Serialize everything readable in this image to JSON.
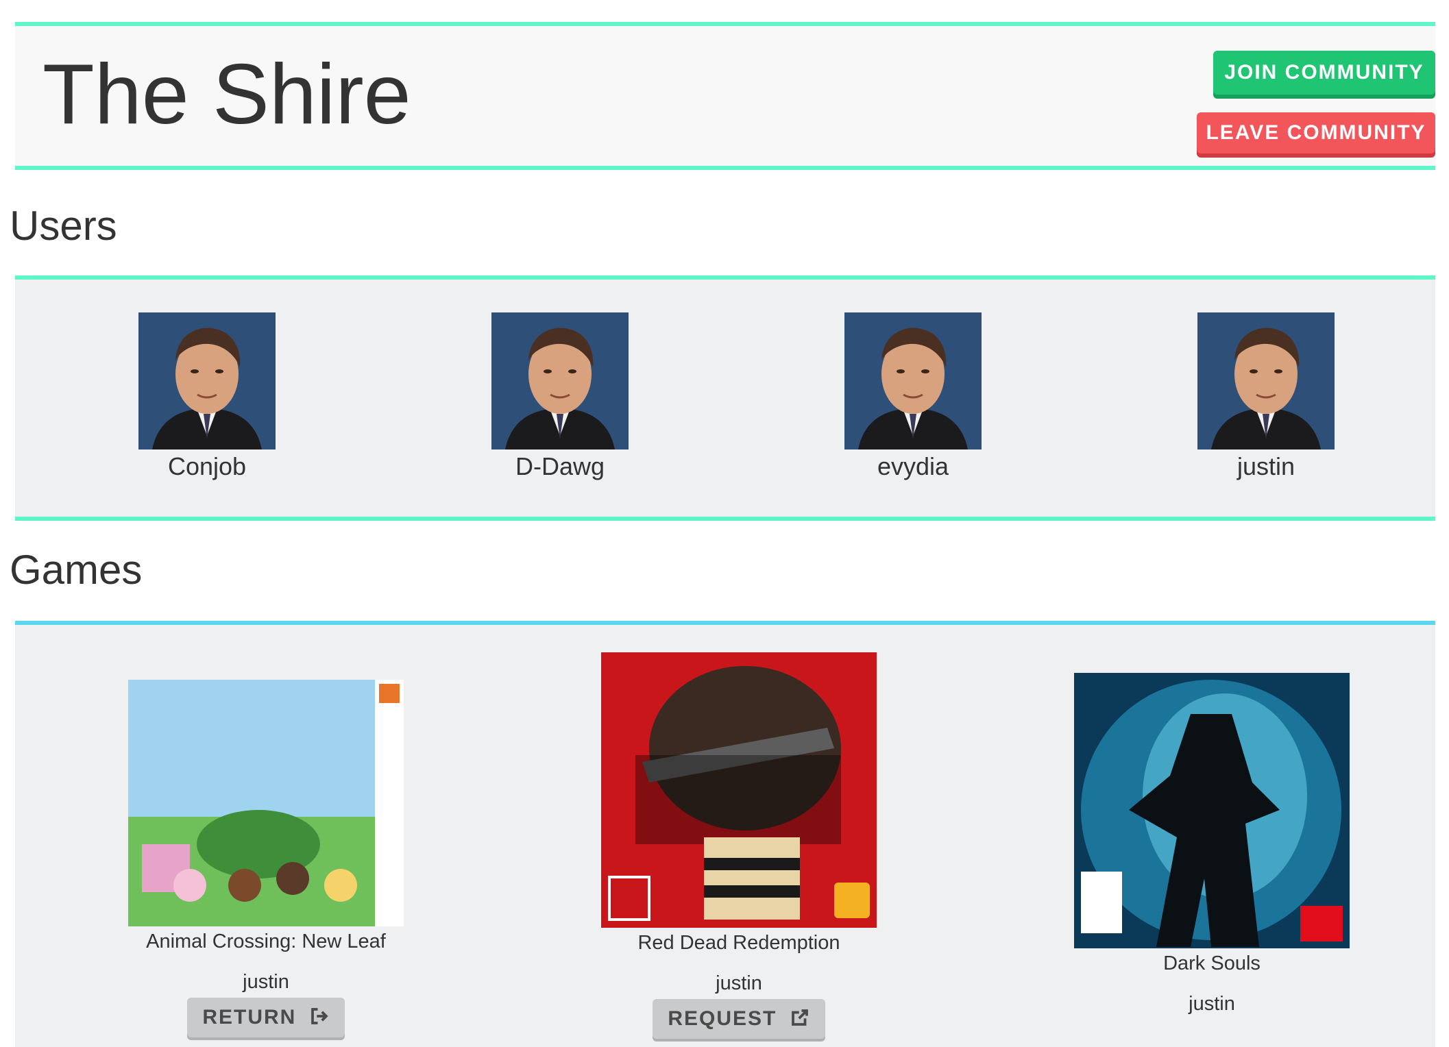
{
  "header": {
    "title": "The Shire",
    "join_label": "JOIN COMMUNITY",
    "leave_label": "LEAVE COMMUNITY"
  },
  "users_section": {
    "title": "Users",
    "items": [
      {
        "name": "Conjob"
      },
      {
        "name": "D-Dawg"
      },
      {
        "name": "evydia"
      },
      {
        "name": "justin"
      }
    ]
  },
  "games_section": {
    "title": "Games",
    "items": [
      {
        "title": "Animal Crossing: New Leaf",
        "owner": "justin",
        "action_label": "RETURN",
        "action_icon": "sign-out-icon"
      },
      {
        "title": "Red Dead Redemption",
        "owner": "justin",
        "action_label": "REQUEST",
        "action_icon": "external-link-icon"
      },
      {
        "title": "Dark Souls",
        "owner": "justin"
      }
    ]
  },
  "colors": {
    "accent_green": "#5ef5c8",
    "accent_blue": "#5ad6ef",
    "join": "#1fc573",
    "leave": "#f2555a"
  }
}
